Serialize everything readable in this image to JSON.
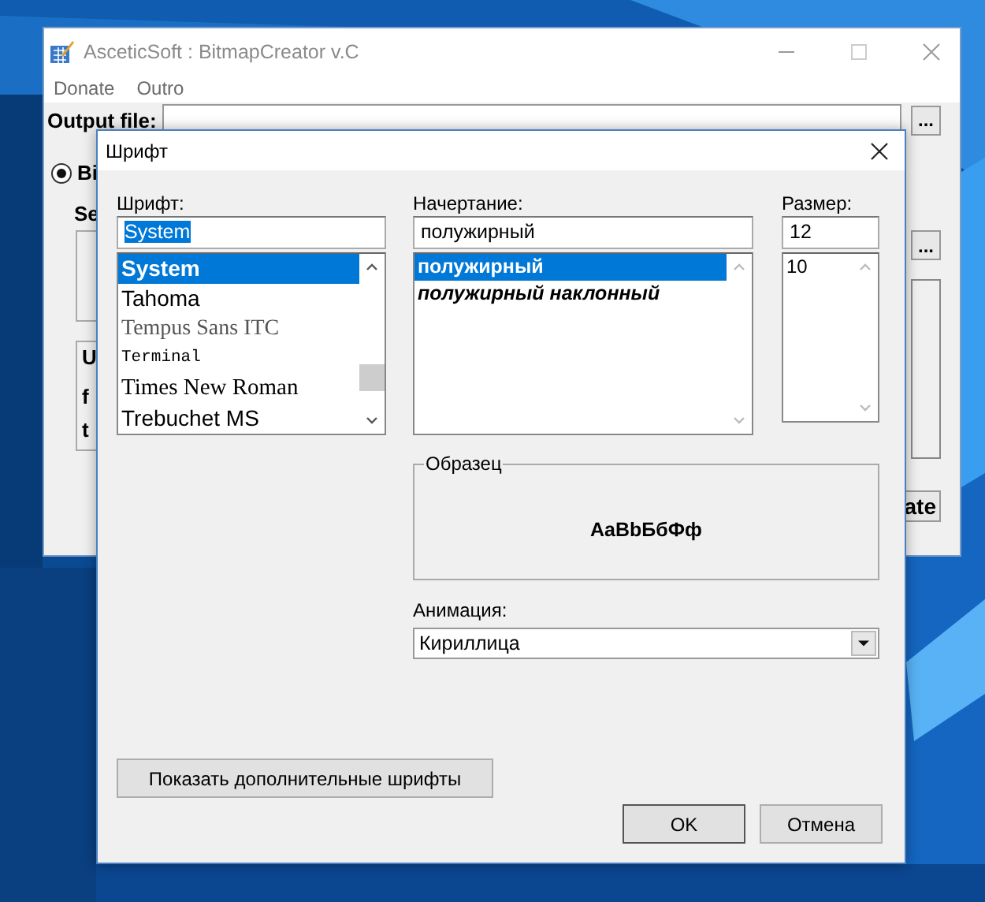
{
  "main_window": {
    "title": "AsceticSoft : BitmapCreator v.C",
    "active": false,
    "menu": [
      "Donate",
      "Outro"
    ],
    "output_label": "Output file:",
    "browse_buttons": [
      "...",
      "..."
    ],
    "radio": {
      "label": "Bi",
      "selected": true
    },
    "section_label": "Se",
    "group_labels": [
      "U",
      "f",
      "t"
    ],
    "button": "ate"
  },
  "dialog": {
    "title": "Шрифт",
    "font": {
      "label": "Шрифт:",
      "value": "System",
      "value_selected": true,
      "items": [
        {
          "label": "System",
          "selected": true
        },
        {
          "label": "Tahoma",
          "selected": false
        },
        {
          "label": "Tempus Sans ITC",
          "selected": false
        },
        {
          "label": "Terminal",
          "selected": false
        },
        {
          "label": "Times New Roman",
          "selected": false
        },
        {
          "label": "Trebuchet MS",
          "selected": false
        }
      ]
    },
    "style": {
      "label": "Начертание:",
      "value": "полужирный",
      "value_selected": false,
      "items": [
        {
          "label": "полужирный",
          "selected": true
        },
        {
          "label": "полужирный наклонный",
          "selected": false
        }
      ]
    },
    "size": {
      "label": "Размер:",
      "value": "12",
      "value_selected": false,
      "items": [
        {
          "label": "10",
          "selected": false
        }
      ]
    },
    "sample": {
      "label": "Образец",
      "text": "AaBbБбФф"
    },
    "script": {
      "label": "Анимация:",
      "value": "Кириллица"
    },
    "more_button": "Показать дополнительные шрифты",
    "ok": "OK",
    "cancel": "Отмена"
  }
}
